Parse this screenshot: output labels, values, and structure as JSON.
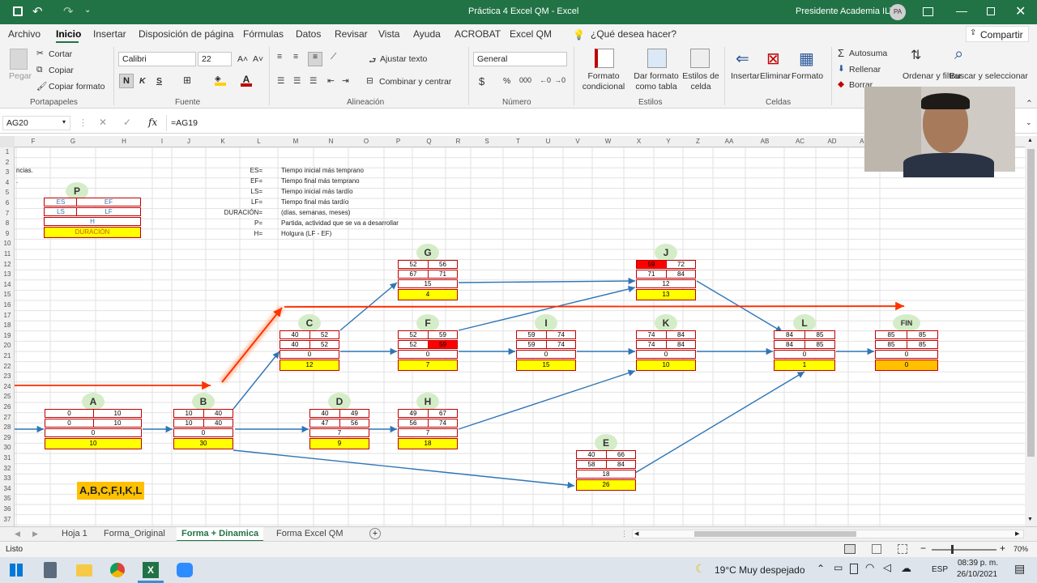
{
  "window": {
    "title": "Práctica 4 Excel QM  -  Excel",
    "user": "Presidente Academia ILT",
    "avatar": "PA"
  },
  "menu": {
    "items": [
      "Archivo",
      "Inicio",
      "Insertar",
      "Disposición de página",
      "Fórmulas",
      "Datos",
      "Revisar",
      "Vista",
      "Ayuda",
      "ACROBAT",
      "Excel QM"
    ],
    "search": "¿Qué desea hacer?",
    "share": "Compartir"
  },
  "ribbon": {
    "clipboard": {
      "paste": "Pegar",
      "cut": "Cortar",
      "copy": "Copiar",
      "format_painter": "Copiar formato",
      "label": "Portapapeles"
    },
    "font": {
      "name": "Calibri",
      "size": "22",
      "bold": "N",
      "italic": "K",
      "underline": "S",
      "label": "Fuente"
    },
    "alignment": {
      "wrap": "Ajustar texto",
      "merge": "Combinar y centrar",
      "label": "Alineación"
    },
    "number": {
      "format": "General",
      "label": "Número"
    },
    "styles": {
      "cond": "Formato condicional",
      "table": "Dar formato como tabla",
      "cell": "Estilos de celda",
      "label": "Estilos"
    },
    "cells": {
      "insert": "Insertar",
      "delete": "Eliminar",
      "format": "Formato",
      "label": "Celdas"
    },
    "editing": {
      "autosum": "Autosuma",
      "fill": "Rellenar",
      "clear": "Borrar",
      "sort": "Ordenar y filtrar",
      "find": "Buscar y seleccionar"
    }
  },
  "formula_bar": {
    "name_box": "AG20",
    "formula": "=AG19"
  },
  "columns": [
    "F",
    "G",
    "H",
    "I",
    "J",
    "K",
    "L",
    "M",
    "N",
    "O",
    "P",
    "Q",
    "R",
    "S",
    "T",
    "U",
    "V",
    "W",
    "X",
    "Y",
    "Z",
    "AA",
    "AB",
    "AC",
    "AD",
    "AE"
  ],
  "rows": [
    "1",
    "2",
    "3",
    "4",
    "5",
    "6",
    "7",
    "8",
    "9",
    "10",
    "11",
    "12",
    "13",
    "14",
    "15",
    "16",
    "17",
    "18",
    "19",
    "20",
    "21",
    "22",
    "23",
    "24",
    "25",
    "26",
    "27",
    "28",
    "29",
    "30",
    "31",
    "32",
    "33",
    "34",
    "35",
    "36",
    "37"
  ],
  "sheet_text": {
    "r3": "ncias.",
    "r4": "."
  },
  "legend_node": {
    "bubble": "P",
    "es": "ES",
    "ef": "EF",
    "ls": "LS",
    "lf": "LF",
    "h": "H",
    "dur": "DURACIÓN"
  },
  "definitions": [
    {
      "key": "ES=",
      "desc": "Tiempo inicial más temprano"
    },
    {
      "key": "EF=",
      "desc": "Tiempo final más temprano"
    },
    {
      "key": "LS=",
      "desc": "Tiempo inicial más tardío"
    },
    {
      "key": "LF=",
      "desc": "Tiempo final más tardío"
    },
    {
      "key": "DURACIÓN=",
      "desc": "(días, semanas, meses)"
    },
    {
      "key": "P=",
      "desc": "Partida, actividad que se va a desarrollar"
    },
    {
      "key": "H=",
      "desc": "Holgura (LF - EF)"
    }
  ],
  "nodes": [
    {
      "id": "A",
      "es": "0",
      "ef": "10",
      "ls": "0",
      "lf": "10",
      "h": "0",
      "dur": "10"
    },
    {
      "id": "B",
      "es": "10",
      "ef": "40",
      "ls": "10",
      "lf": "40",
      "h": "0",
      "dur": "30"
    },
    {
      "id": "C",
      "es": "40",
      "ef": "52",
      "ls": "40",
      "lf": "52",
      "h": "0",
      "dur": "12"
    },
    {
      "id": "D",
      "es": "40",
      "ef": "49",
      "ls": "47",
      "lf": "56",
      "h": "7",
      "dur": "9"
    },
    {
      "id": "G",
      "es": "52",
      "ef": "56",
      "ls": "67",
      "lf": "71",
      "h": "15",
      "dur": "4"
    },
    {
      "id": "F",
      "es": "52",
      "ef": "59",
      "ls": "52",
      "lf": "59",
      "h": "0",
      "dur": "7"
    },
    {
      "id": "H",
      "es": "49",
      "ef": "67",
      "ls": "56",
      "lf": "74",
      "h": "7",
      "dur": "18"
    },
    {
      "id": "I",
      "es": "59",
      "ef": "74",
      "ls": "59",
      "lf": "74",
      "h": "0",
      "dur": "15"
    },
    {
      "id": "E",
      "es": "40",
      "ef": "66",
      "ls": "58",
      "lf": "84",
      "h": "18",
      "dur": "26"
    },
    {
      "id": "J",
      "es": "59",
      "ef": "72",
      "ls": "71",
      "lf": "84",
      "h": "12",
      "dur": "13"
    },
    {
      "id": "K",
      "es": "74",
      "ef": "84",
      "ls": "74",
      "lf": "84",
      "h": "0",
      "dur": "10"
    },
    {
      "id": "L",
      "es": "84",
      "ef": "85",
      "ls": "84",
      "lf": "85",
      "h": "0",
      "dur": "1"
    },
    {
      "id": "FIN",
      "es": "85",
      "ef": "85",
      "ls": "85",
      "lf": "85",
      "h": "0",
      "dur": "0"
    }
  ],
  "critical_path": "A,B,C,F,I,K,L",
  "sheets": [
    "Hoja 1",
    "Forma_Original",
    "Forma + Dinamica",
    "Forma Excel QM"
  ],
  "active_sheet": "Forma + Dinamica",
  "status": {
    "ready": "Listo",
    "zoom": "70%"
  },
  "taskbar": {
    "weather": "19°C  Muy despejado",
    "lang": "ESP",
    "time": "08:39 p. m.",
    "date": "26/10/2021"
  }
}
